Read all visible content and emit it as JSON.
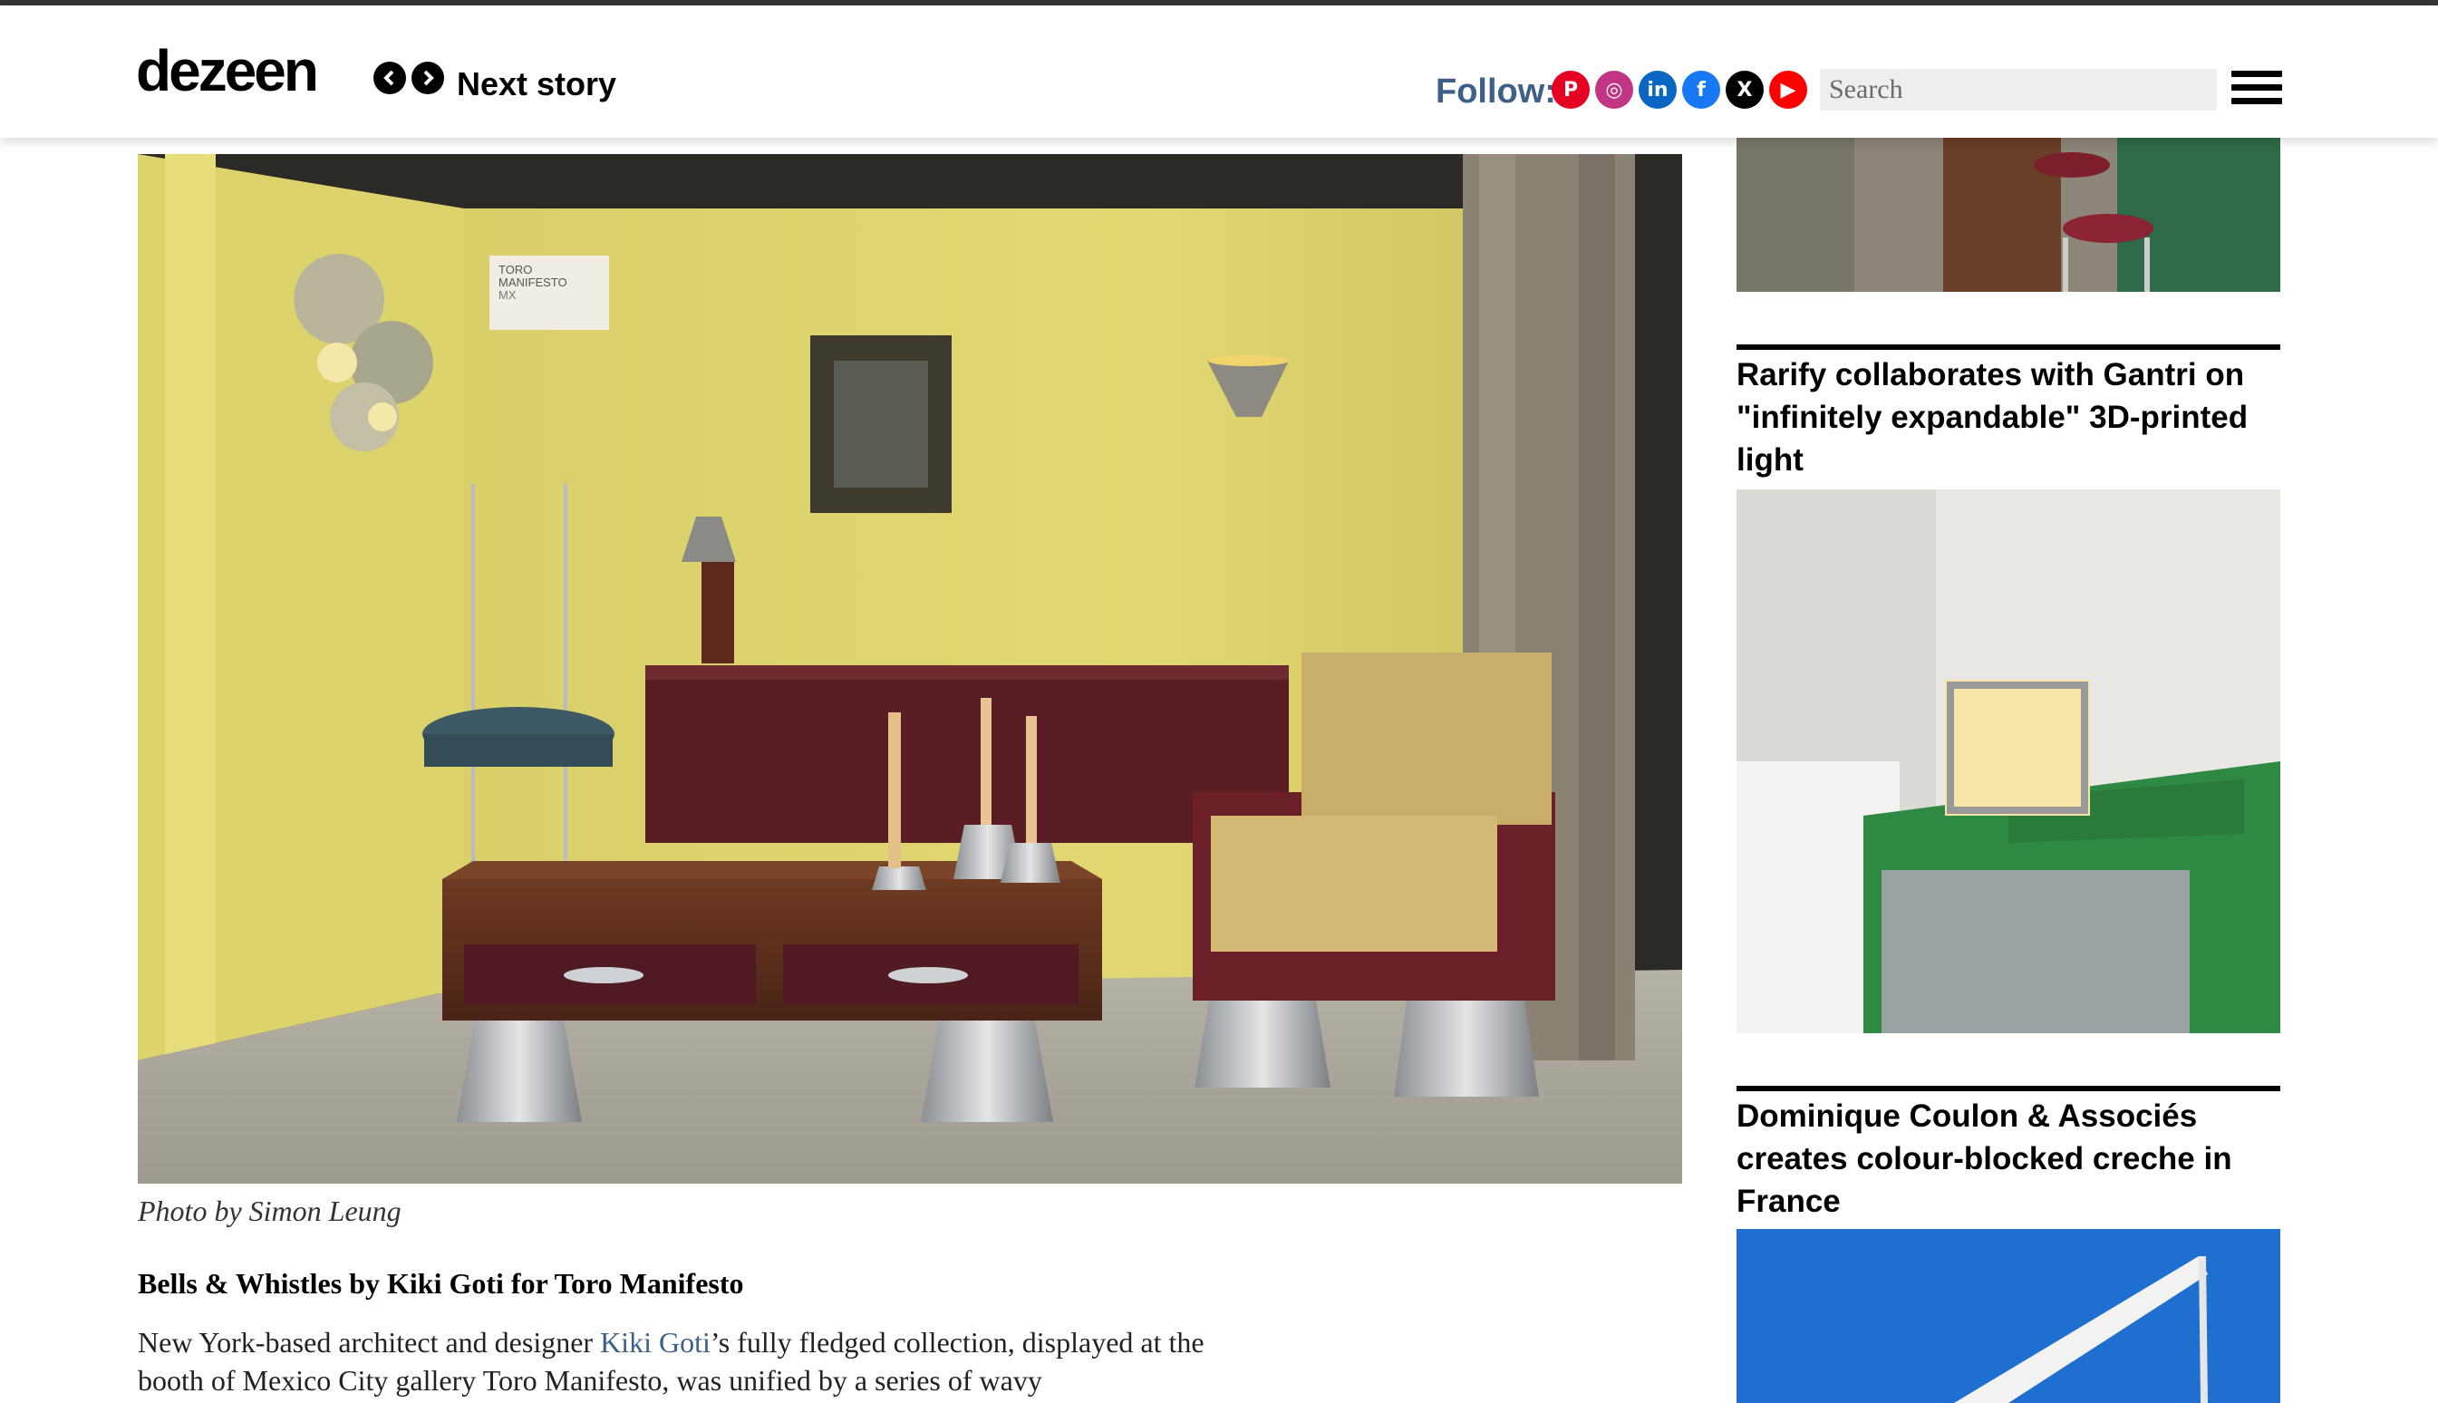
{
  "header": {
    "logo": "dezeen",
    "next_story": "Next story",
    "follow_label": "Follow:",
    "social": [
      {
        "icon": "pinterest-icon",
        "glyph": "P",
        "color": "#e60023"
      },
      {
        "icon": "instagram-icon",
        "glyph": "◎",
        "color": "#c13584"
      },
      {
        "icon": "linkedin-icon",
        "glyph": "in",
        "color": "#0a66c2"
      },
      {
        "icon": "facebook-icon",
        "glyph": "f",
        "color": "#1877f2"
      },
      {
        "icon": "x-icon",
        "glyph": "X",
        "color": "#000000"
      },
      {
        "icon": "youtube-icon",
        "glyph": "▶",
        "color": "#ff0000"
      }
    ],
    "search_placeholder": "Search"
  },
  "article": {
    "photo_caption": "Photo by Simon Leung",
    "subheading": "Bells & Whistles by Kiki Goti for Toro Manifesto",
    "body_before_link": "New York-based architect and designer ",
    "body_link": "Kiki Goti",
    "body_after_link": "’s fully fledged collection, displayed at the booth of Mexico City gallery Toro Manifesto, was unified by a series of wavy",
    "photo_sign": {
      "line1": "TORO",
      "line2": "MANIFESTO",
      "line3": "MX"
    }
  },
  "sidebar": {
    "stories": [
      {
        "title": "Rarify collaborates with Gantri on \"infinitely expandable\" 3D-printed light"
      },
      {
        "title": "Dominique Coulon & Associés creates colour-blocked creche in France"
      }
    ]
  },
  "colors": {
    "link": "#3e5f8a",
    "follow": "#3e5f8a",
    "search_bg": "#eeeeee"
  }
}
